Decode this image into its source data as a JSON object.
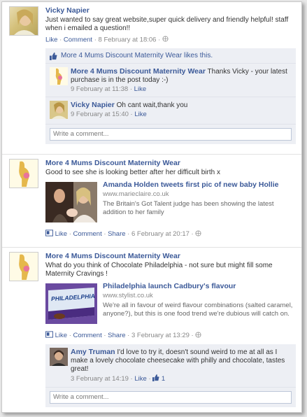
{
  "feed": {
    "post1": {
      "author": "Vicky Napier",
      "text": "Just wanted to say great website,super quick delivery  and friendly helpful! staff when i emailed a question!!",
      "like": "Like",
      "comment": "Comment",
      "time": "8 February at 18:06",
      "likes_text": "More 4 Mums Discount Maternity Wear likes this.",
      "replies": [
        {
          "author": "More 4 Mums Discount Maternity Wear",
          "text": "Thanks Vicky - your latest purchase is in the post today :-)",
          "time": "9 February at 11:38",
          "like": "Like"
        },
        {
          "author": "Vicky Napier",
          "text": "Oh cant wait,thank you",
          "time": "9 February at 15:40",
          "like": "Like"
        }
      ],
      "comment_placeholder": "Write a comment..."
    },
    "post2": {
      "author": "More 4 Mums Discount Maternity Wear",
      "text": "Good to see she is looking better after her difficult birth x",
      "share_title": "Amanda Holden tweets first pic of new baby Hollie",
      "share_url": "www.marieclaire.co.uk",
      "share_desc": "The Britain's Got Talent judge has been showing the latest addition to her family",
      "like": "Like",
      "comment": "Comment",
      "share": "Share",
      "time": "6 February at 20:17"
    },
    "post3": {
      "author": "More 4 Mums Discount Maternity Wear",
      "text": "What do you think of Chocolate Philadelphia - not sure but might fill some Maternity Cravings !",
      "share_title": "Philadelphia launch Cadbury's flavour",
      "share_url": "www.stylist.co.uk",
      "share_desc": "We're all in favour of weird flavour combinations (salted caramel, anyone?), but this is one food trend we're dubious will catch on.",
      "thumb_brand": "PHILADELPHIA",
      "like": "Like",
      "comment": "Comment",
      "share": "Share",
      "time": "3 February at 13:29",
      "reply": {
        "author": "Amy Truman",
        "text": "I'd love to try it, doesn't sound weird to me at all as I make a lovely chocolate cheesecake with philly and chocolate, tastes great!",
        "time": "3 February at 14:19",
        "like": "Like",
        "like_count": "1"
      },
      "comment_placeholder": "Write a comment..."
    }
  },
  "colors": {
    "link": "#3b5998",
    "sub_bg": "#edeff4"
  }
}
